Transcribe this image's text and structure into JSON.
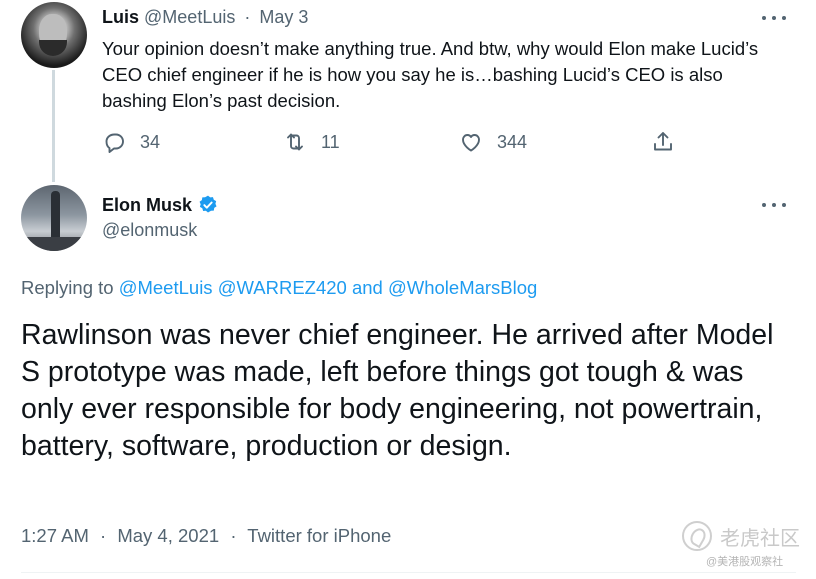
{
  "reply_tweet": {
    "name": "Luis",
    "handle": "@MeetLuis",
    "separator": "·",
    "date": "May 3",
    "text": "Your opinion doesn’t make anything true. And btw, why would Elon make Lucid’s CEO chief engineer if he is how you say he is…bashing Lucid’s CEO is also bashing Elon’s past decision.",
    "actions": {
      "reply_icon": "reply-icon",
      "reply_count": "34",
      "retweet_icon": "retweet-icon",
      "retweet_count": "11",
      "like_icon": "like-icon",
      "like_count": "344",
      "share_icon": "share-icon"
    }
  },
  "main_tweet": {
    "name": "Elon Musk",
    "verified_icon": "verified-badge-icon",
    "handle": "@elonmusk",
    "replying_prefix": "Replying to",
    "replying_mentions": [
      "@MeetLuis",
      "@WARREZ420"
    ],
    "replying_and": "and",
    "replying_last": "@WholeMarsBlog",
    "text": "Rawlinson was never chief engineer. He arrived after Model S prototype was made, left before things got tough & was only ever responsible for body engineering, not powertrain, battery, software, production or design.",
    "time": "1:27 AM",
    "separator": "·",
    "date": "May 4, 2021",
    "source": "Twitter for iPhone"
  },
  "watermark": {
    "logo": "老虎社区",
    "credit": "@美港股观察社"
  },
  "colors": {
    "accent": "#1d9bf0",
    "muted": "#536471",
    "text": "#0f1419",
    "thread_line": "#cfd9de"
  }
}
